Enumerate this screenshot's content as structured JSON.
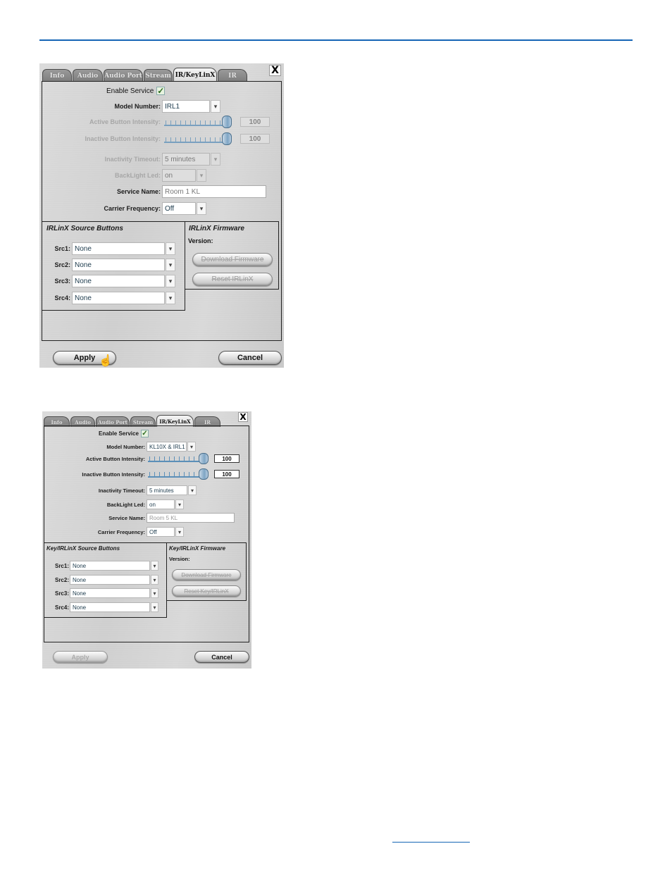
{
  "page": {
    "accent_color": "#1565b5"
  },
  "dialogs": [
    {
      "tabs": [
        "Info",
        "Audio",
        "Audio Port",
        "Stream",
        "IR/KeyLinX",
        "IR"
      ],
      "active_tab": "IR/KeyLinX",
      "close_label": "X",
      "enable_service": {
        "label": "Enable Service",
        "checked": true,
        "check_glyph": "✓"
      },
      "model_number": {
        "label": "Model Number:",
        "value": "IRL1",
        "arrow": "▾"
      },
      "active_intensity": {
        "label": "Active Button Intensity:",
        "value": "100",
        "level_percent": 100
      },
      "inactive_intensity": {
        "label": "Inactive Button Intensity:",
        "value": "100",
        "level_percent": 100
      },
      "inactivity_timeout": {
        "label": "Inactivity Timeout:",
        "value": "5 minutes",
        "arrow": "▾"
      },
      "backlight_led": {
        "label": "BackLight Led:",
        "value": "on",
        "arrow": "▾"
      },
      "service_name": {
        "label": "Service Name:",
        "value": "Room 1 KL"
      },
      "carrier_frequency": {
        "label": "Carrier Frequency:",
        "value": "Off",
        "arrow": "▾"
      },
      "source_buttons": {
        "title": "IRLinX Source Buttons",
        "items": [
          {
            "label": "Src1:",
            "value": "None"
          },
          {
            "label": "Src2:",
            "value": "None"
          },
          {
            "label": "Src3:",
            "value": "None"
          },
          {
            "label": "Src4:",
            "value": "None"
          }
        ]
      },
      "firmware": {
        "title": "IRLinX Firmware",
        "version_label": "Version:",
        "download_label": "Download Firmware",
        "reset_label": "Reset IRLinX"
      },
      "apply_label": "Apply",
      "cancel_label": "Cancel",
      "cursor_glyph": "☝"
    },
    {
      "tabs": [
        "Info",
        "Audio",
        "Audio Port",
        "Stream",
        "IR/KeyLinX",
        "IR"
      ],
      "active_tab": "IR/KeyLinX",
      "close_label": "X",
      "enable_service": {
        "label": "Enable Service",
        "checked": true,
        "check_glyph": "✓"
      },
      "model_number": {
        "label": "Model Number:",
        "value": "KL10X & IRL1",
        "arrow": "▾"
      },
      "active_intensity": {
        "label": "Active Button Intensity:",
        "value": "100",
        "level_percent": 100
      },
      "inactive_intensity": {
        "label": "Inactive Button Intensity:",
        "value": "100",
        "level_percent": 100
      },
      "inactivity_timeout": {
        "label": "Inactivity Timeout:",
        "value": "5 minutes",
        "arrow": "▾"
      },
      "backlight_led": {
        "label": "BackLight Led:",
        "value": "on",
        "arrow": "▾"
      },
      "service_name": {
        "label": "Service Name:",
        "value": "Room 5 KL"
      },
      "carrier_frequency": {
        "label": "Carrier Frequency:",
        "value": "Off",
        "arrow": "▾"
      },
      "source_buttons": {
        "title": "Key/IRLinX Source Buttons",
        "items": [
          {
            "label": "Src1:",
            "value": "None"
          },
          {
            "label": "Src2:",
            "value": "None"
          },
          {
            "label": "Src3:",
            "value": "None"
          },
          {
            "label": "Src4:",
            "value": "None"
          }
        ]
      },
      "firmware": {
        "title": "Key/IRLinX Firmware",
        "version_label": "Version:",
        "download_label": "Download Firmware",
        "reset_label": "Reset Key/IRLinX"
      },
      "apply_label": "Apply",
      "cancel_label": "Cancel"
    }
  ]
}
